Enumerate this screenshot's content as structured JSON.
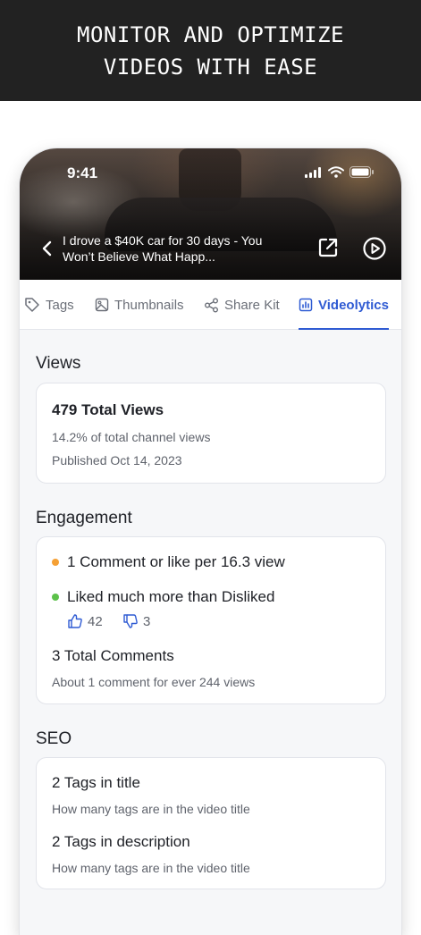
{
  "banner": {
    "line1": "MONITOR AND OPTIMIZE",
    "line2": "VIDEOS WITH EASE"
  },
  "status_bar": {
    "time": "9:41"
  },
  "video": {
    "title": "I drove a $40K car for 30 days - You Won’t Believe What Happ..."
  },
  "tabs": [
    {
      "label": "Tags",
      "icon": "tag-icon",
      "active": false
    },
    {
      "label": "Thumbnails",
      "icon": "image-icon",
      "active": false
    },
    {
      "label": "Share Kit",
      "icon": "share-icon",
      "active": false
    },
    {
      "label": "Videolytics",
      "icon": "bar-chart-icon",
      "active": true
    }
  ],
  "views": {
    "title": "Views",
    "total": "479 Total Views",
    "percent": "14.2% of total channel views",
    "published": "Published Oct 14, 2023"
  },
  "engagement": {
    "title": "Engagement",
    "rate": "1 Comment or like per 16.3 view",
    "sentiment": "Liked much more than Disliked",
    "likes": "42",
    "dislikes": "3",
    "comments": "3 Total Comments",
    "comments_sub": "About 1 comment for ever 244 views",
    "rate_dot_color": "#f5a034",
    "sentiment_dot_color": "#5cc14a"
  },
  "seo": {
    "title": "SEO",
    "tags_title": "2 Tags in title",
    "tags_title_sub": "How many tags are in the video title",
    "tags_desc": "2 Tags in description",
    "tags_desc_sub": "How many tags are in the video title"
  },
  "colors": {
    "accent": "#2f5bd3",
    "banner_bg": "#222222"
  }
}
